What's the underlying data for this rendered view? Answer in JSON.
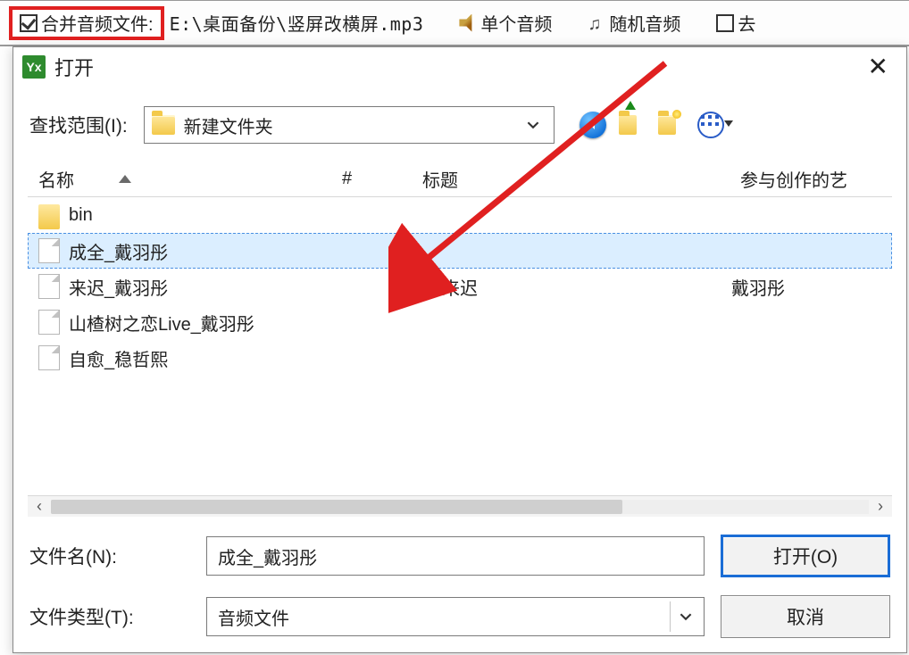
{
  "topstrip": {
    "merge_label": "合并音频文件:",
    "path": "E:\\桌面备份\\竖屏改横屏.mp3",
    "single_audio": "单个音频",
    "random_audio": "随机音频",
    "trail_label": "去"
  },
  "dialog": {
    "title": "打开",
    "lookin_label": "查找范围(I):",
    "lookin_value": "新建文件夹",
    "columns": {
      "name": "名称",
      "num": "#",
      "title": "标题",
      "artist": "参与创作的艺"
    },
    "rows": [
      {
        "name": "bin",
        "type": "folder",
        "title": "",
        "artist": "",
        "selected": false
      },
      {
        "name": "成全_戴羽彤",
        "type": "file",
        "title": "",
        "artist": "",
        "selected": true
      },
      {
        "name": "来迟_戴羽彤",
        "type": "file",
        "title": "来迟",
        "artist": "戴羽彤",
        "selected": false
      },
      {
        "name": "山楂树之恋Live_戴羽彤",
        "type": "file",
        "title": "",
        "artist": "",
        "selected": false
      },
      {
        "name": "自愈_稳哲熙",
        "type": "file",
        "title": "",
        "artist": "",
        "selected": false
      }
    ],
    "filename_label": "文件名(N):",
    "filename_value": "成全_戴羽彤",
    "filetype_label": "文件类型(T):",
    "filetype_value": "音频文件",
    "open_btn": "打开(O)",
    "cancel_btn": "取消"
  }
}
